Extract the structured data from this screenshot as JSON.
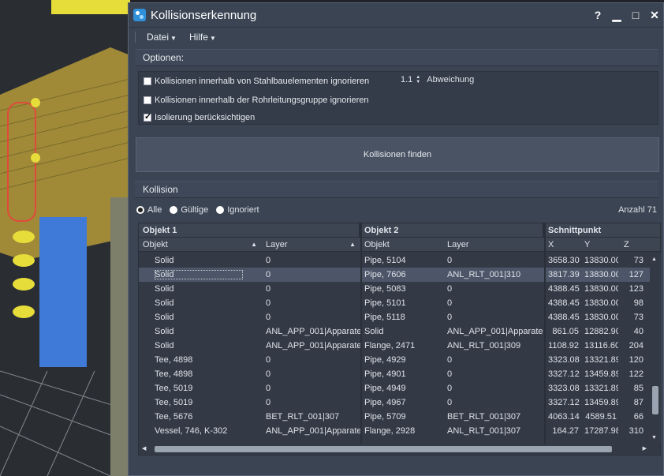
{
  "window": {
    "title": "Kollisionserkennung"
  },
  "menu": {
    "items": [
      {
        "label": "Datei"
      },
      {
        "label": "Hilfe"
      }
    ]
  },
  "options": {
    "header": "Optionen:",
    "ignore_steel": {
      "label": "Kollisionen innerhalb von Stahlbauelementen ignorieren",
      "checked": false
    },
    "deviation": {
      "value": "1.1",
      "label": "Abweichung"
    },
    "ignore_pipe_group": {
      "label": "Kollisionen innerhalb der Rohrleitungsgruppe ignorieren",
      "checked": false
    },
    "insulation": {
      "label": "Isolierung berücksichtigen",
      "checked": true
    }
  },
  "find_button": {
    "label": "Kollisionen finden"
  },
  "collision": {
    "header": "Kollision",
    "filters": [
      {
        "label": "Alle",
        "selected": true
      },
      {
        "label": "Gültige",
        "selected": false
      },
      {
        "label": "Ignoriert",
        "selected": false
      }
    ],
    "count_label": "Anzahl 71"
  },
  "table": {
    "groups": [
      "Objekt 1",
      "Objekt 2",
      "Schnittpunkt"
    ],
    "columns": [
      "Objekt",
      "Layer",
      "Objekt",
      "Layer",
      "X",
      "Y",
      "Z"
    ],
    "rows": [
      [
        "Solid",
        "0",
        "Pipe, 5104",
        "0",
        "3658.30",
        "13830.00",
        "73"
      ],
      [
        "Solid",
        "0",
        "Pipe, 7606",
        "ANL_RLT_001|310",
        "3817.39",
        "13830.00",
        "127"
      ],
      [
        "Solid",
        "0",
        "Pipe, 5083",
        "0",
        "4388.45",
        "13830.00",
        "123"
      ],
      [
        "Solid",
        "0",
        "Pipe, 5101",
        "0",
        "4388.45",
        "13830.00",
        "98"
      ],
      [
        "Solid",
        "0",
        "Pipe, 5118",
        "0",
        "4388.45",
        "13830.00",
        "73"
      ],
      [
        "Solid",
        "ANL_APP_001|Apparate",
        "Solid",
        "ANL_APP_001|Apparate",
        "861.05",
        "12882.90",
        "40"
      ],
      [
        "Solid",
        "ANL_APP_001|Apparate",
        "Flange, 2471",
        "ANL_RLT_001|309",
        "1108.92",
        "13116.60",
        "204"
      ],
      [
        "Tee, 4898",
        "0",
        "Pipe, 4929",
        "0",
        "3323.08",
        "13321.89",
        "120"
      ],
      [
        "Tee, 4898",
        "0",
        "Pipe, 4901",
        "0",
        "3327.12",
        "13459.89",
        "122"
      ],
      [
        "Tee, 5019",
        "0",
        "Pipe, 4949",
        "0",
        "3323.08",
        "13321.89",
        "85"
      ],
      [
        "Tee, 5019",
        "0",
        "Pipe, 4967",
        "0",
        "3327.12",
        "13459.89",
        "87"
      ],
      [
        "Tee, 5676",
        "BET_RLT_001|307",
        "Pipe, 5709",
        "BET_RLT_001|307",
        "4063.14",
        "4589.51",
        "66"
      ],
      [
        "Vessel, 746, K-302",
        "ANL_APP_001|Apparate",
        "Flange, 2928",
        "ANL_RLT_001|307",
        "164.27",
        "17287.98",
        "310"
      ]
    ],
    "selected_row": 1
  },
  "colors": {
    "dialog_bg": "#3b4453",
    "selected_row": "#4d5669"
  }
}
